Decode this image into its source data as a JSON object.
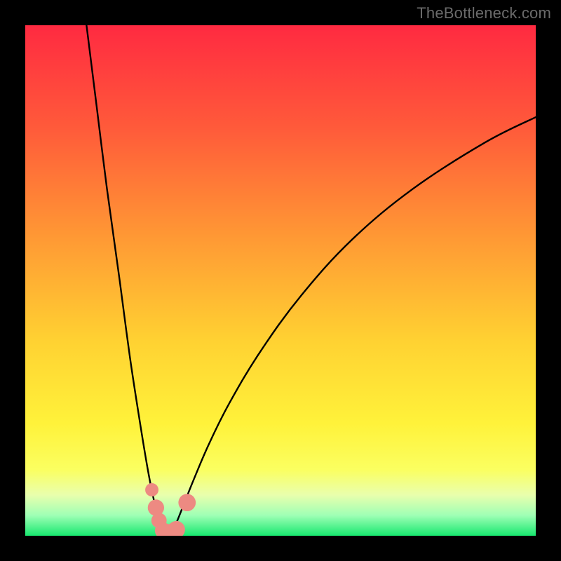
{
  "watermark": "TheBottleneck.com",
  "colors": {
    "frame": "#000000",
    "curve": "#000000",
    "marker_fill": "#ed8a82",
    "marker_stroke": "#d86a63",
    "gradient_stops": [
      {
        "offset": 0.0,
        "hex": "#ff2a41"
      },
      {
        "offset": 0.2,
        "hex": "#ff5a3a"
      },
      {
        "offset": 0.42,
        "hex": "#ff9a34"
      },
      {
        "offset": 0.62,
        "hex": "#ffd232"
      },
      {
        "offset": 0.78,
        "hex": "#fff23a"
      },
      {
        "offset": 0.87,
        "hex": "#fbff60"
      },
      {
        "offset": 0.92,
        "hex": "#e9ffad"
      },
      {
        "offset": 0.96,
        "hex": "#9fffb5"
      },
      {
        "offset": 1.0,
        "hex": "#18e86f"
      }
    ]
  },
  "chart_data": {
    "type": "line",
    "title": "",
    "xlabel": "",
    "ylabel": "",
    "xlim": [
      0,
      100
    ],
    "ylim": [
      0,
      100
    ],
    "grid": false,
    "legend": false,
    "series": [
      {
        "name": "left-branch",
        "x": [
          12,
          14,
          16,
          18.5,
          20.5,
          22.5,
          24,
          25.2,
          26.3,
          27.2
        ],
        "y": [
          100,
          84,
          68,
          50,
          35,
          22,
          13,
          7,
          3,
          0.8
        ]
      },
      {
        "name": "right-branch",
        "x": [
          28.8,
          29.8,
          31,
          33,
          36,
          40,
          46,
          54,
          64,
          76,
          90,
          100
        ],
        "y": [
          0.8,
          3,
          6,
          11,
          18,
          26,
          36,
          47,
          58,
          68,
          77,
          82
        ]
      },
      {
        "name": "valley-floor",
        "x": [
          27.2,
          28,
          28.8
        ],
        "y": [
          0.8,
          0.5,
          0.8
        ]
      }
    ],
    "markers": {
      "name": "highlighted-points",
      "points": [
        {
          "x": 24.8,
          "y": 9.0,
          "r": 1.3
        },
        {
          "x": 25.6,
          "y": 5.5,
          "r": 1.6
        },
        {
          "x": 26.2,
          "y": 3.0,
          "r": 1.5
        },
        {
          "x": 27.0,
          "y": 1.0,
          "r": 1.6
        },
        {
          "x": 28.3,
          "y": 0.6,
          "r": 1.7
        },
        {
          "x": 29.6,
          "y": 1.2,
          "r": 1.7
        },
        {
          "x": 31.7,
          "y": 6.5,
          "r": 1.7
        }
      ]
    }
  }
}
